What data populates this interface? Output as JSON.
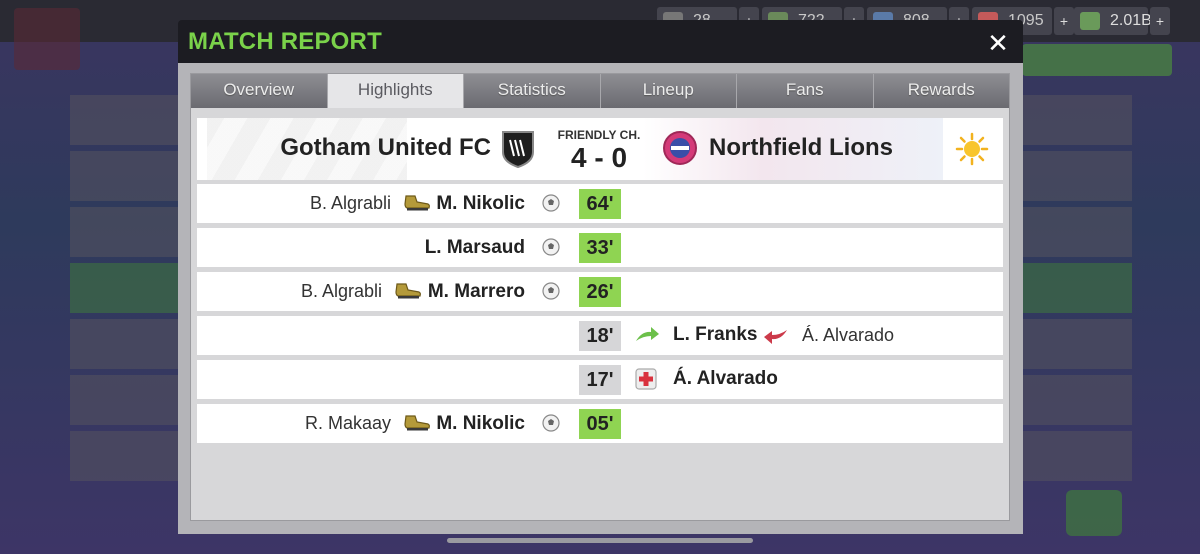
{
  "resources": [
    "28",
    "722",
    "808",
    "1095",
    "2.01B"
  ],
  "modal": {
    "title": "MATCH REPORT",
    "close_label": "✕",
    "tabs": [
      "Overview",
      "Highlights",
      "Statistics",
      "Lineup",
      "Fans",
      "Rewards"
    ],
    "active_tab": "Highlights"
  },
  "match": {
    "home_team": "Gotham United FC",
    "away_team": "Northfield Lions",
    "competition": "FRIENDLY CH.",
    "score": "4 - 0",
    "weather": "sunny-icon"
  },
  "events": [
    {
      "type": "goal",
      "assist": "B. Algrabli",
      "scorer": "M. Nikolic",
      "minute": "64'"
    },
    {
      "type": "goal",
      "assist": "",
      "scorer": "L. Marsaud",
      "minute": "33'"
    },
    {
      "type": "goal",
      "assist": "B. Algrabli",
      "scorer": "M. Marrero",
      "minute": "26'"
    },
    {
      "type": "substitution",
      "minute": "18'",
      "player_in": "L. Franks",
      "player_out": "Á. Alvarado"
    },
    {
      "type": "injury",
      "minute": "17'",
      "player": "Á. Alvarado"
    },
    {
      "type": "goal",
      "assist": "R. Makaay",
      "scorer": "M. Nikolic",
      "minute": "05'"
    }
  ],
  "colors": {
    "accent_green": "#7ad24a",
    "goal_minute_bg": "#8fd452"
  }
}
